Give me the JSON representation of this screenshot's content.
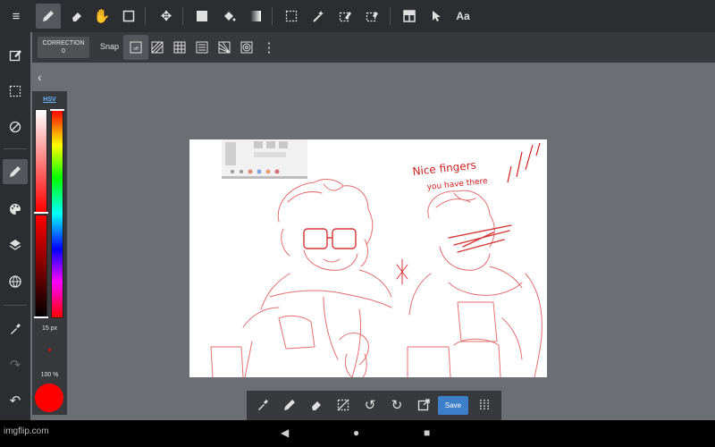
{
  "toolbar": {
    "tools": [
      {
        "name": "brush-tool",
        "icon": "pencil-icon",
        "active": true
      },
      {
        "name": "eraser-tool",
        "icon": "eraser-icon"
      },
      {
        "name": "hand-tool",
        "icon": "hand-icon"
      },
      {
        "name": "fill-rect-tool",
        "icon": "square-outline-icon"
      },
      {
        "name": "move-tool",
        "icon": "move-icon"
      },
      {
        "name": "shape-fill-tool",
        "icon": "filled-square-icon"
      },
      {
        "name": "bucket-tool",
        "icon": "paint-bucket-icon"
      },
      {
        "name": "gradient-tool",
        "icon": "gradient-icon"
      },
      {
        "name": "select-tool",
        "icon": "dashed-square-icon"
      },
      {
        "name": "magic-wand-tool",
        "icon": "magic-wand-icon"
      },
      {
        "name": "select-pen-tool",
        "icon": "select-pen-icon"
      },
      {
        "name": "select-eraser-tool",
        "icon": "select-eraser-icon"
      },
      {
        "name": "divide-frame-tool",
        "icon": "frame-icon"
      },
      {
        "name": "operation-tool",
        "icon": "cursor-icon"
      },
      {
        "name": "text-tool",
        "icon": "text-icon"
      }
    ],
    "text_label": "Aa"
  },
  "subbar": {
    "correction_label": "CORRECTION",
    "correction_value": "0",
    "snap_label": "Snap"
  },
  "color_panel": {
    "mode_label": "HSV",
    "brush_size": "15 px",
    "opacity": "100 %",
    "current_color": "#ff0000",
    "saturation": 0.0,
    "value": 1.0,
    "hue": 0
  },
  "bottom_toolbar": {
    "save_label": "Save"
  },
  "canvas": {
    "annotation_text_line1": "Nice fingers",
    "annotation_text_line2": "you have there"
  },
  "watermark": "imgflip.com"
}
